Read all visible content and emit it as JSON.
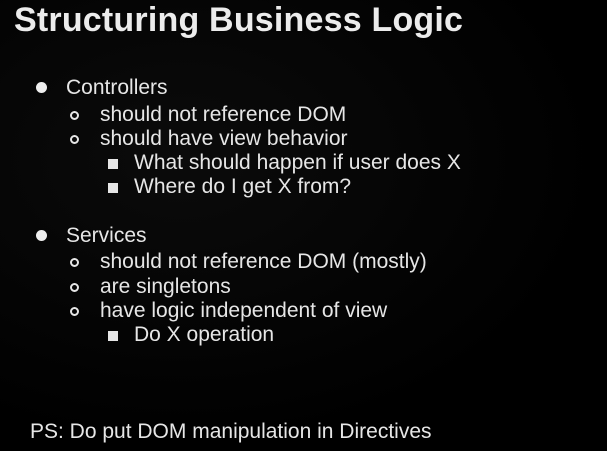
{
  "slide": {
    "title": "Structuring Business Logic",
    "sections": [
      {
        "label": "Controllers",
        "items": [
          {
            "label": "should not reference DOM"
          },
          {
            "label": "should have view behavior",
            "subitems": [
              "What should happen if user does X",
              "Where do I get X from?"
            ]
          }
        ]
      },
      {
        "label": "Services",
        "items": [
          {
            "label": "should not reference DOM (mostly)"
          },
          {
            "label": "are singletons"
          },
          {
            "label": "have logic independent of view",
            "subitems": [
              "Do X operation"
            ]
          }
        ]
      }
    ],
    "footer_note": "PS: Do put DOM manipulation in Directives"
  },
  "icons": {
    "level1": "filled-circle-bullet-icon",
    "level2": "hollow-circle-bullet-icon",
    "level3": "filled-square-bullet-icon"
  },
  "colors": {
    "background": "#000000",
    "text": "#e6e6e6"
  }
}
